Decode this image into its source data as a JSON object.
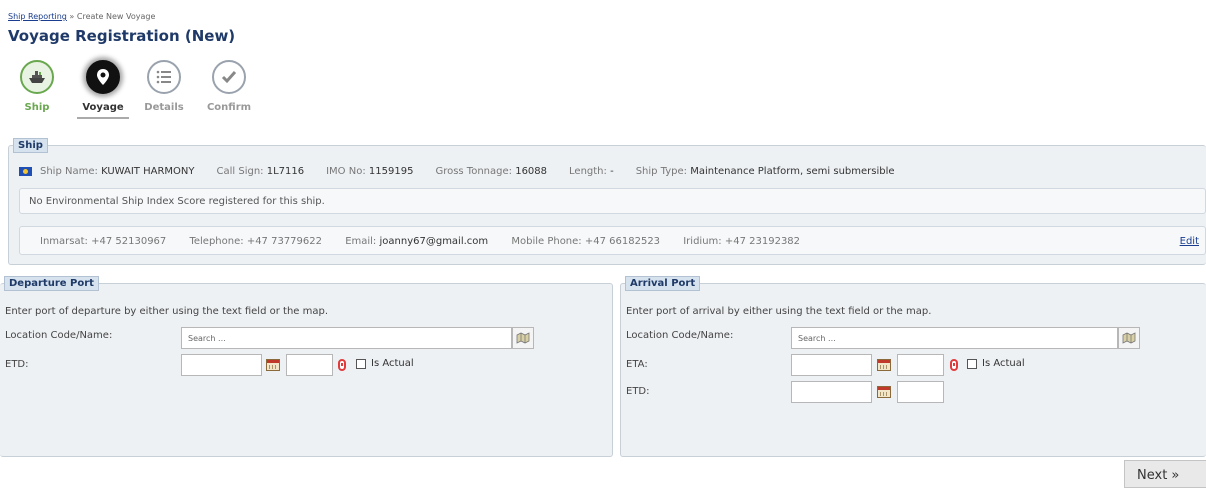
{
  "breadcrumb": {
    "link": "Ship Reporting",
    "separator": " » ",
    "current": "Create New Voyage"
  },
  "page_title": "Voyage Registration (New)",
  "steps": [
    {
      "label": "Ship",
      "icon": "ship-icon",
      "state": "done"
    },
    {
      "label": "Voyage",
      "icon": "location-pin-icon",
      "state": "active"
    },
    {
      "label": "Details",
      "icon": "list-icon",
      "state": "pending"
    },
    {
      "label": "Confirm",
      "icon": "checkmark-icon",
      "state": "pending"
    }
  ],
  "ship": {
    "legend": "Ship",
    "flag_icon": "flag-icon",
    "name_label": "Ship Name:",
    "name": "KUWAIT HARMONY",
    "callsign_label": "Call Sign:",
    "callsign": "1L7116",
    "imo_label": "IMO No:",
    "imo": "1159195",
    "gt_label": "Gross Tonnage:",
    "gt": "16088",
    "length_label": "Length:",
    "length": "-",
    "type_label": "Ship Type:",
    "type": "Maintenance Platform, semi submersible",
    "esi_note": "No Environmental Ship Index Score registered for this ship.",
    "contacts": {
      "inmarsat_label": "Inmarsat:",
      "inmarsat": "+47 52130967",
      "telephone_label": "Telephone:",
      "telephone": "+47 73779622",
      "email_label": "Email:",
      "email": "joanny67@gmail.com",
      "mobile_label": "Mobile Phone:",
      "mobile": "+47 66182523",
      "iridium_label": "Iridium:",
      "iridium": "+47 23192382",
      "edit_label": "Edit"
    }
  },
  "departure": {
    "legend": "Departure Port",
    "intro": "Enter port of departure by either using the text field or the map.",
    "location_label": "Location Code/Name:",
    "search_placeholder": "Search ...",
    "etd_label": "ETD:",
    "is_actual_label": "Is Actual"
  },
  "arrival": {
    "legend": "Arrival Port",
    "intro": "Enter port of arrival by either using the text field or the map.",
    "location_label": "Location Code/Name:",
    "search_placeholder": "Search ...",
    "eta_label": "ETA:",
    "etd_label": "ETD:",
    "is_actual_label": "Is Actual"
  },
  "next_label": "Next »",
  "colors": {
    "title": "#1f3a68",
    "done_step": "#6aa84f",
    "legend_bg": "#d6e2ee",
    "panel_bg": "#eef1f4"
  }
}
